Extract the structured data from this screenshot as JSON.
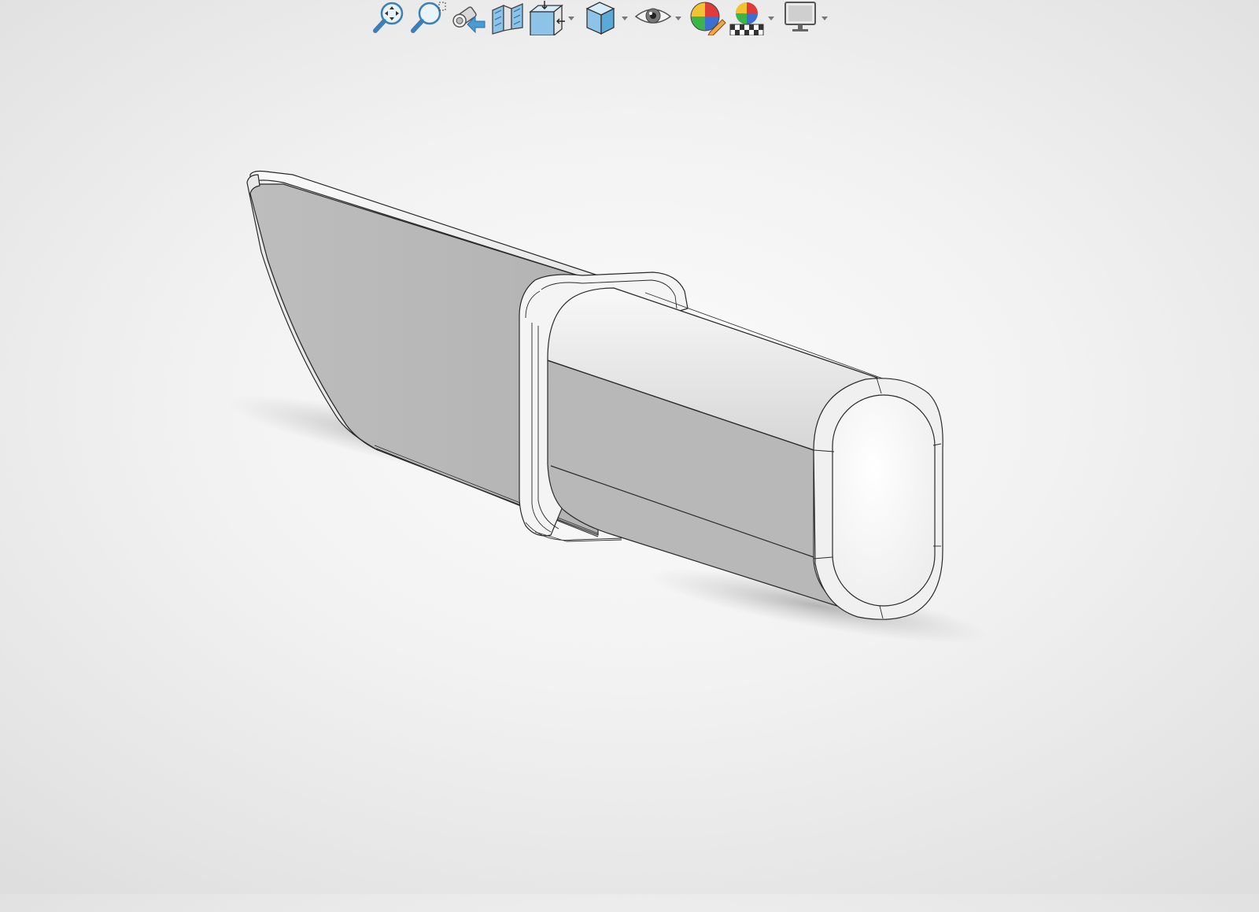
{
  "toolbar": {
    "items": [
      {
        "icon": "zoom-to-fit-icon",
        "has_dropdown": false
      },
      {
        "icon": "zoom-to-area-icon",
        "has_dropdown": false
      },
      {
        "icon": "previous-view-icon",
        "has_dropdown": false
      },
      {
        "icon": "section-view-icon",
        "has_dropdown": false
      },
      {
        "icon": "view-orientation-icon",
        "has_dropdown": true
      },
      {
        "icon": "display-style-icon",
        "has_dropdown": true
      },
      {
        "icon": "hide-show-items-icon",
        "has_dropdown": true
      },
      {
        "icon": "edit-appearance-icon",
        "has_dropdown": false
      },
      {
        "icon": "apply-scene-icon",
        "has_dropdown": true
      },
      {
        "icon": "view-settings-icon",
        "has_dropdown": true
      }
    ]
  },
  "colors": {
    "background_center": "#fbfbfb",
    "background_edge": "#dedede",
    "model_dark_face": "#b7b7b7",
    "model_light_face": "#f7f7f7",
    "edge_line": "#2a2a2a",
    "icon_blue": "#5aa9d6"
  }
}
